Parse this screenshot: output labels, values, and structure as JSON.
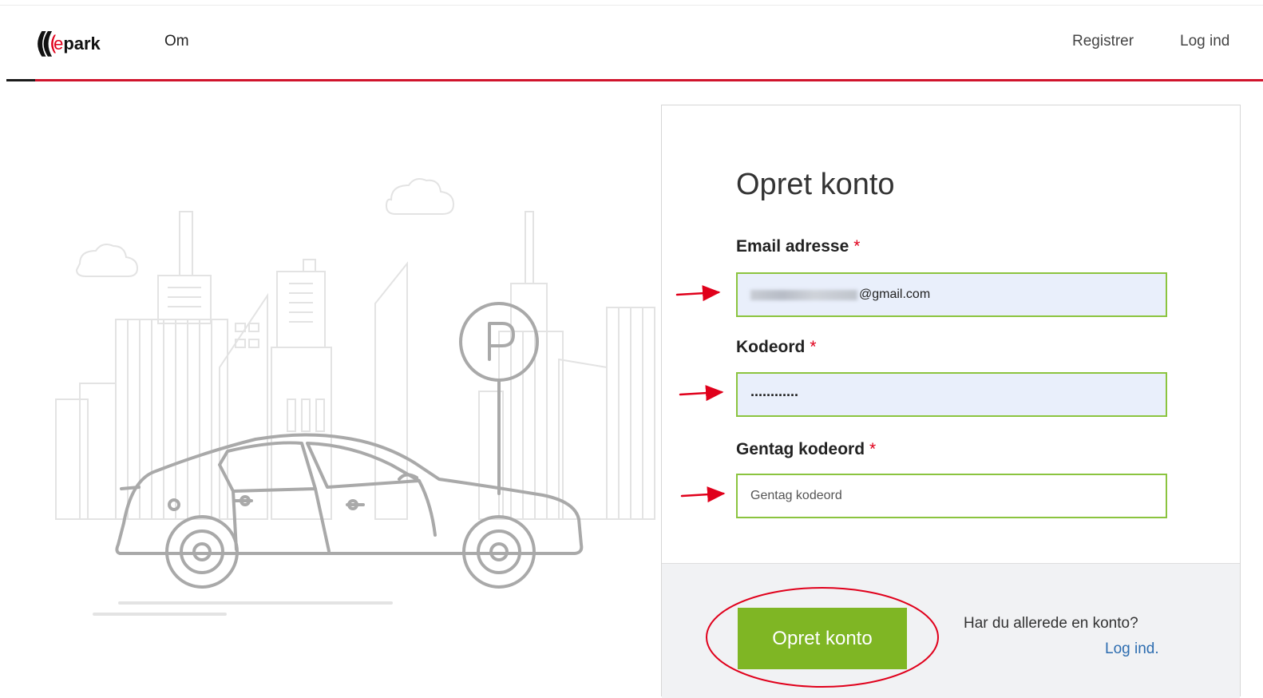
{
  "header": {
    "logo": {
      "e": "e",
      "park": "park"
    },
    "nav_left": [
      "Om"
    ],
    "nav_right": {
      "register": "Registrer",
      "login": "Log ind"
    }
  },
  "form": {
    "title": "Opret konto",
    "email": {
      "label": "Email adresse",
      "required_mark": "*",
      "value_visible": "@gmail.com"
    },
    "password": {
      "label": "Kodeord",
      "required_mark": "*",
      "value": "............"
    },
    "repeat_password": {
      "label": "Gentag kodeord",
      "required_mark": "*",
      "placeholder": "Gentag kodeord"
    },
    "submit_label": "Opret konto",
    "footer_question": "Har du allerede en konto?",
    "footer_link": "Log ind."
  },
  "colors": {
    "brand_red": "#d0142c",
    "button_green": "#7fb624",
    "field_border": "#8bc43f",
    "field_fill": "#e9effb",
    "link_blue": "#2d6db0",
    "annotation_red": "#e0001b"
  },
  "icons": [
    "logo-waves-icon",
    "parking-sign-icon",
    "car-illustration",
    "city-skyline-illustration",
    "cloud-icon",
    "annotation-arrow-icon",
    "annotation-circle"
  ]
}
